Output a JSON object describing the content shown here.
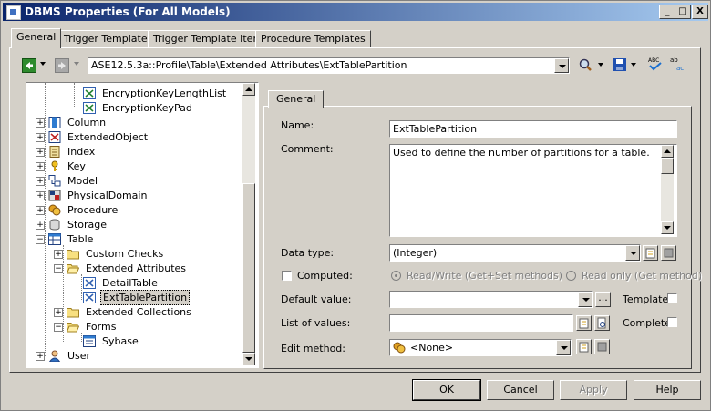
{
  "window": {
    "title": "DBMS Properties (For All Models)"
  },
  "tabs": [
    "General",
    "Trigger Templates",
    "Trigger Template Items",
    "Procedure Templates"
  ],
  "toolbar": {
    "path": "ASE12.5.3a::Profile\\Table\\Extended Attributes\\ExtTablePartition"
  },
  "tree": {
    "items": [
      {
        "label": "EncryptionKeyLengthList",
        "icon": "extended-attribute-icon"
      },
      {
        "label": "EncryptionKeyPad",
        "icon": "extended-attribute-icon"
      },
      {
        "label": "Column",
        "icon": "column-icon"
      },
      {
        "label": "ExtendedObject",
        "icon": "extended-object-icon"
      },
      {
        "label": "Index",
        "icon": "index-icon"
      },
      {
        "label": "Key",
        "icon": "key-icon"
      },
      {
        "label": "Model",
        "icon": "model-icon"
      },
      {
        "label": "PhysicalDomain",
        "icon": "physical-domain-icon"
      },
      {
        "label": "Procedure",
        "icon": "procedure-icon"
      },
      {
        "label": "Storage",
        "icon": "storage-icon"
      },
      {
        "label": "Table",
        "icon": "table-icon"
      },
      {
        "label": "Custom Checks",
        "icon": "folder-icon"
      },
      {
        "label": "Extended Attributes",
        "icon": "folder-open-icon"
      },
      {
        "label": "DetailTable",
        "icon": "extended-attribute-icon"
      },
      {
        "label": "ExtTablePartition",
        "icon": "extended-attribute-icon"
      },
      {
        "label": "Extended Collections",
        "icon": "folder-icon"
      },
      {
        "label": "Forms",
        "icon": "folder-open-icon"
      },
      {
        "label": "Sybase",
        "icon": "form-icon"
      },
      {
        "label": "User",
        "icon": "user-icon"
      }
    ]
  },
  "props": {
    "tab": "General",
    "name_label": "Name:",
    "name_value": "ExtTablePartition",
    "comment_label": "Comment:",
    "comment_value": "Used to define the number of partitions for a table.",
    "datatype_label": "Data type:",
    "datatype_value": "(Integer)",
    "computed_label": "Computed:",
    "rw_label": "Read/Write (Get+Set methods)",
    "ro_label": "Read only (Get method)",
    "default_label": "Default value:",
    "default_value": "",
    "template_label": "Template",
    "list_label": "List of values:",
    "list_value": "",
    "complete_label": "Complete",
    "edit_label": "Edit method:",
    "edit_value": "<None>"
  },
  "buttons": {
    "ok": "OK",
    "cancel": "Cancel",
    "apply": "Apply",
    "help": "Help"
  },
  "titlebar_buttons": {
    "minimize": "_",
    "maximize": "□",
    "close": "X"
  }
}
